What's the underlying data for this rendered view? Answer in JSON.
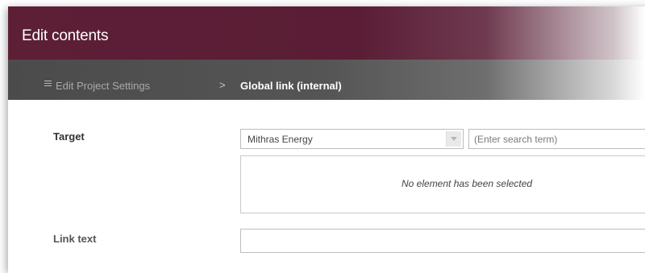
{
  "window": {
    "title": "Edit contents"
  },
  "breadcrumb": {
    "items": [
      {
        "label": "Edit Project Settings"
      },
      {
        "label": "Global link (internal)"
      }
    ],
    "separator": ">"
  },
  "form": {
    "target": {
      "label": "Target",
      "project_select_value": "Mithras Energy",
      "search_placeholder": "(Enter search term)",
      "search_value": "",
      "selection_empty_text": "No element has been selected"
    },
    "link_text": {
      "label": "Link text",
      "value": ""
    }
  },
  "colors": {
    "title_bar": "#5a1d35",
    "breadcrumb_bar": "#4b4b4b"
  },
  "icons": {
    "breadcrumb_menu": "menu-icon",
    "select_arrow": "chevron-down-icon"
  }
}
